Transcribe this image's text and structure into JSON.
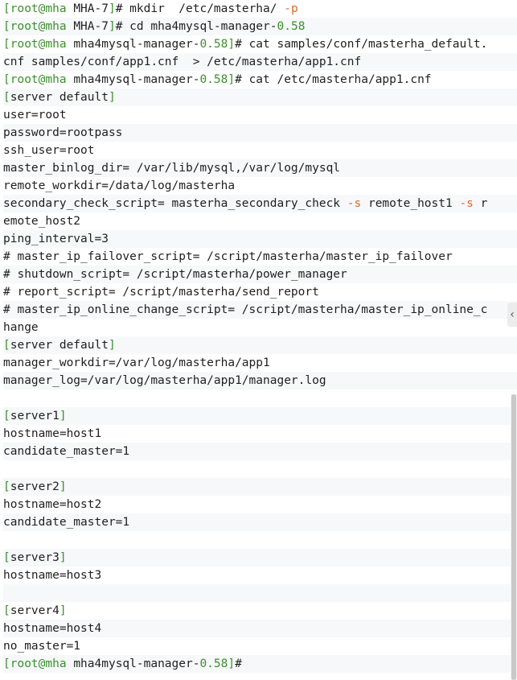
{
  "terminal": {
    "lines": [
      [
        {
          "t": "[root@mha ",
          "c": "green"
        },
        {
          "t": "MHA-7",
          "c": "plain"
        },
        {
          "t": "]",
          "c": "green"
        },
        {
          "t": "# mkdir  /etc/masterha/ ",
          "c": "plain"
        },
        {
          "t": "-p",
          "c": "orange"
        }
      ],
      [
        {
          "t": "[root@mha ",
          "c": "green"
        },
        {
          "t": "MHA-7",
          "c": "plain"
        },
        {
          "t": "]",
          "c": "green"
        },
        {
          "t": "# cd mha4mysql-manager-",
          "c": "plain"
        },
        {
          "t": "0.58",
          "c": "green"
        }
      ],
      [
        {
          "t": "[root@mha ",
          "c": "green"
        },
        {
          "t": "mha4mysql-manager-",
          "c": "plain"
        },
        {
          "t": "0.58",
          "c": "green"
        },
        {
          "t": "]",
          "c": "green"
        },
        {
          "t": "# cat samples/conf/masterha_default.",
          "c": "plain"
        }
      ],
      [
        {
          "t": "cnf samples/conf/app1.cnf  > /etc/masterha/app1.cnf",
          "c": "plain"
        }
      ],
      [
        {
          "t": "[root@mha ",
          "c": "green"
        },
        {
          "t": "mha4mysql-manager-",
          "c": "plain"
        },
        {
          "t": "0.58",
          "c": "green"
        },
        {
          "t": "]",
          "c": "green"
        },
        {
          "t": "# cat /etc/masterha/app1.cnf",
          "c": "plain"
        }
      ],
      [
        {
          "t": "[",
          "c": "green"
        },
        {
          "t": "server default",
          "c": "plain"
        },
        {
          "t": "]",
          "c": "green"
        }
      ],
      [
        {
          "t": "user=root",
          "c": "plain"
        }
      ],
      [
        {
          "t": "password=rootpass",
          "c": "plain"
        }
      ],
      [
        {
          "t": "ssh_user=root",
          "c": "plain"
        }
      ],
      [
        {
          "t": "master_binlog_dir= /var/lib/mysql,/var/log/mysql",
          "c": "plain"
        }
      ],
      [
        {
          "t": "remote_workdir=/data/log/masterha",
          "c": "plain"
        }
      ],
      [
        {
          "t": "secondary_check_script= masterha_secondary_check ",
          "c": "plain"
        },
        {
          "t": "-s",
          "c": "orange"
        },
        {
          "t": " remote_host1 ",
          "c": "plain"
        },
        {
          "t": "-s",
          "c": "orange"
        },
        {
          "t": " r",
          "c": "plain"
        }
      ],
      [
        {
          "t": "emote_host2",
          "c": "plain"
        }
      ],
      [
        {
          "t": "ping_interval=3",
          "c": "plain"
        }
      ],
      [
        {
          "t": "# master_ip_failover_script= /script/masterha/master_ip_failover",
          "c": "plain"
        }
      ],
      [
        {
          "t": "# shutdown_script= /script/masterha/power_manager",
          "c": "plain"
        }
      ],
      [
        {
          "t": "# report_script= /script/masterha/send_report",
          "c": "plain"
        }
      ],
      [
        {
          "t": "# master_ip_online_change_script= /script/masterha/master_ip_online_c",
          "c": "plain"
        }
      ],
      [
        {
          "t": "hange",
          "c": "plain"
        }
      ],
      [
        {
          "t": "[",
          "c": "green"
        },
        {
          "t": "server default",
          "c": "plain"
        },
        {
          "t": "]",
          "c": "green"
        }
      ],
      [
        {
          "t": "manager_workdir=/var/log/masterha/app1",
          "c": "plain"
        }
      ],
      [
        {
          "t": "manager_log=/var/log/masterha/app1/manager.log",
          "c": "plain"
        }
      ],
      [],
      [
        {
          "t": "[",
          "c": "green"
        },
        {
          "t": "server1",
          "c": "plain"
        },
        {
          "t": "]",
          "c": "green"
        }
      ],
      [
        {
          "t": "hostname=host1",
          "c": "plain"
        }
      ],
      [
        {
          "t": "candidate_master=1",
          "c": "plain"
        }
      ],
      [],
      [
        {
          "t": "[",
          "c": "green"
        },
        {
          "t": "server2",
          "c": "plain"
        },
        {
          "t": "]",
          "c": "green"
        }
      ],
      [
        {
          "t": "hostname=host2",
          "c": "plain"
        }
      ],
      [
        {
          "t": "candidate_master=1",
          "c": "plain"
        }
      ],
      [],
      [
        {
          "t": "[",
          "c": "green"
        },
        {
          "t": "server3",
          "c": "plain"
        },
        {
          "t": "]",
          "c": "green"
        }
      ],
      [
        {
          "t": "hostname=host3",
          "c": "plain"
        }
      ],
      [],
      [
        {
          "t": "[",
          "c": "green"
        },
        {
          "t": "server4",
          "c": "plain"
        },
        {
          "t": "]",
          "c": "green"
        }
      ],
      [
        {
          "t": "hostname=host4",
          "c": "plain"
        }
      ],
      [
        {
          "t": "no_master=1",
          "c": "plain"
        }
      ],
      [
        {
          "t": "[root@mha ",
          "c": "green"
        },
        {
          "t": "mha4mysql-manager-",
          "c": "plain"
        },
        {
          "t": "0.58",
          "c": "green"
        },
        {
          "t": "]",
          "c": "green"
        },
        {
          "t": "#",
          "c": "plain"
        }
      ]
    ]
  },
  "icons": {
    "collapse_handle": "chevron-left-icon"
  },
  "colors": {
    "prompt": "#3c8f2c",
    "flag": "#d9692c",
    "text": "#1f1f1f",
    "stripe": "#f6f8fa"
  }
}
